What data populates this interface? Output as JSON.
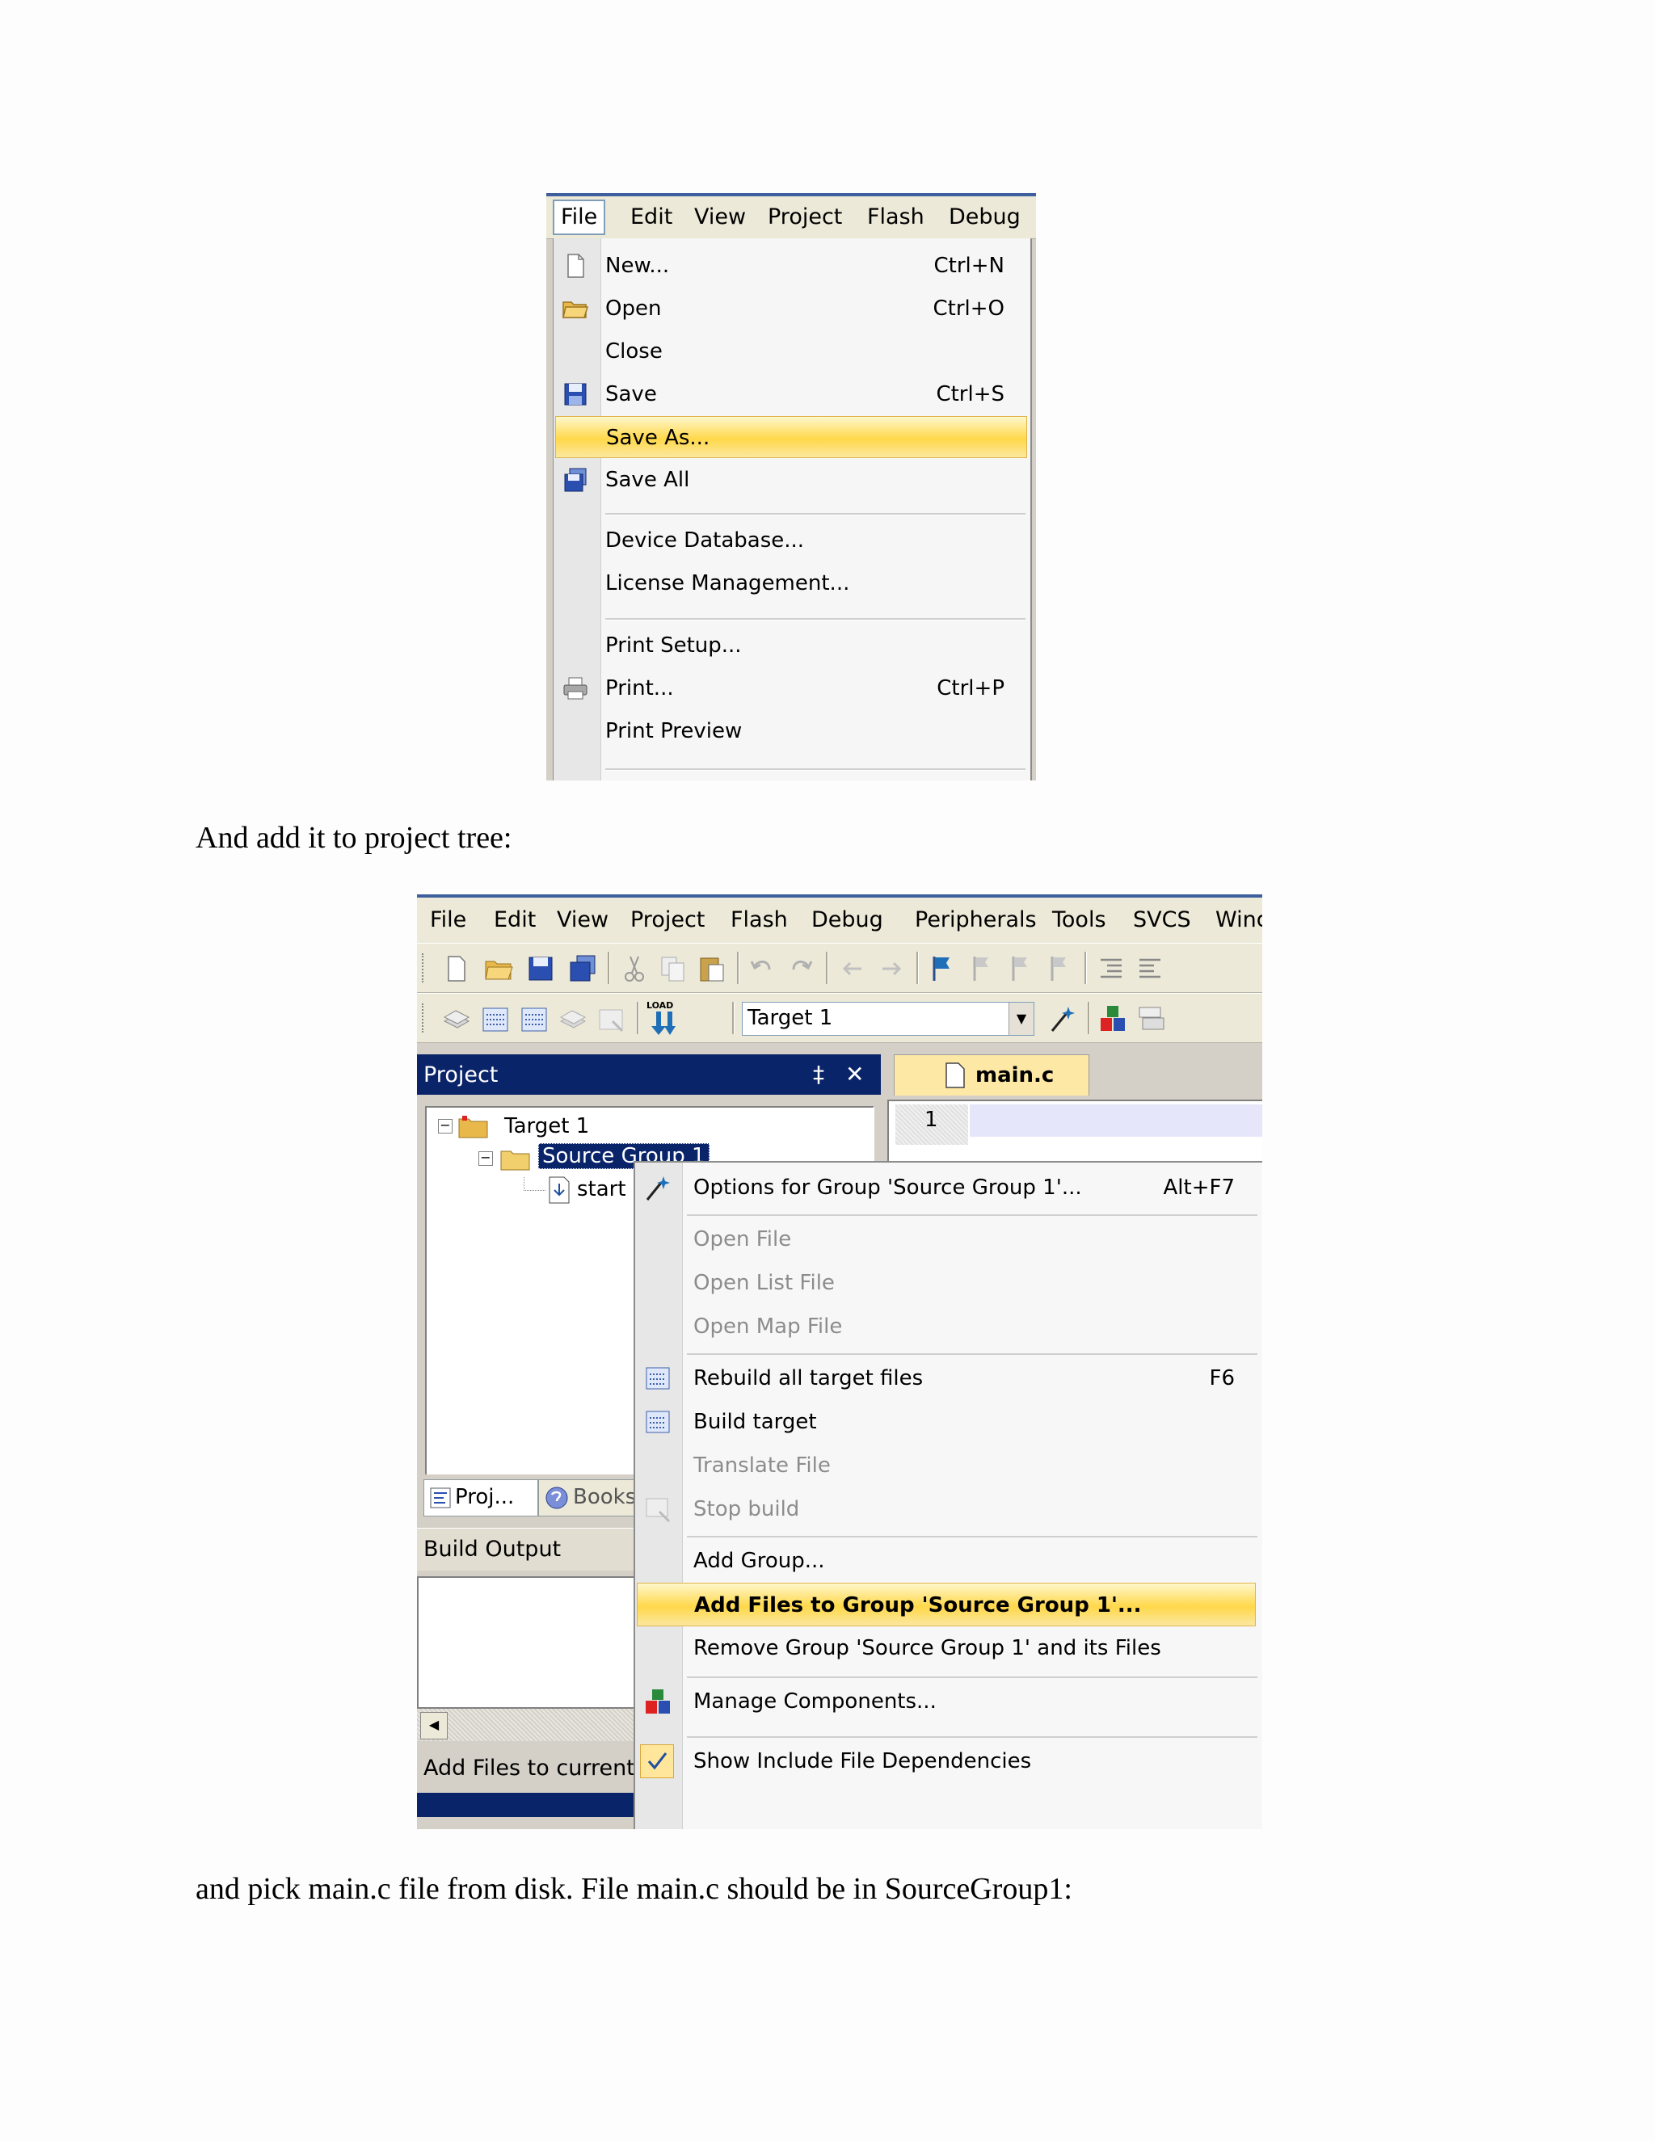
{
  "file_menu_shot": {
    "menubar": [
      "File",
      "Edit",
      "View",
      "Project",
      "Flash",
      "Debug"
    ],
    "items": [
      {
        "label": "New...",
        "shortcut": "Ctrl+N",
        "icon": "new-document-icon"
      },
      {
        "label": "Open",
        "shortcut": "Ctrl+O",
        "icon": "open-folder-icon"
      },
      {
        "label": "Close",
        "shortcut": "",
        "icon": ""
      },
      {
        "label": "Save",
        "shortcut": "Ctrl+S",
        "icon": "save-disk-icon"
      },
      {
        "label": "Save As...",
        "shortcut": "",
        "icon": "",
        "highlighted": true
      },
      {
        "label": "Save All",
        "shortcut": "",
        "icon": "save-all-icon"
      },
      {
        "label": "Device Database...",
        "shortcut": "",
        "icon": ""
      },
      {
        "label": "License Management...",
        "shortcut": "",
        "icon": ""
      },
      {
        "label": "Print Setup...",
        "shortcut": "",
        "icon": ""
      },
      {
        "label": "Print...",
        "shortcut": "Ctrl+P",
        "icon": "printer-icon"
      },
      {
        "label": "Print Preview",
        "shortcut": "",
        "icon": ""
      }
    ]
  },
  "text": {
    "para1": "And add it to project tree:",
    "para2": "and pick main.c file from disk. File main.c should be in SourceGroup1:"
  },
  "ide_shot": {
    "menubar": [
      "File",
      "Edit",
      "View",
      "Project",
      "Flash",
      "Debug",
      "Peripherals",
      "Tools",
      "SVCS",
      "Wind"
    ],
    "target_combo": "Target 1",
    "load_label": "LOAD",
    "project_panel_title": "Project",
    "pin_glyph": "‡",
    "close_glyph": "✕",
    "tree": {
      "target": "Target 1",
      "group": "Source Group 1",
      "file": "start"
    },
    "tabs": [
      "Proj...",
      "Books"
    ],
    "build_output_title": "Build Output",
    "status_text": "Add Files to current P",
    "editor_tab": "main.c",
    "line_number": "1",
    "context_menu": [
      {
        "label": "Options for Group 'Source Group 1'...",
        "shortcut": "Alt+F7",
        "disabled": false,
        "icon": "magic-wand-icon"
      },
      {
        "label": "Open File",
        "shortcut": "",
        "disabled": true,
        "icon": ""
      },
      {
        "label": "Open List File",
        "shortcut": "",
        "disabled": true,
        "icon": ""
      },
      {
        "label": "Open Map File",
        "shortcut": "",
        "disabled": true,
        "icon": ""
      },
      {
        "label": "Rebuild all target files",
        "shortcut": "F6",
        "disabled": false,
        "icon": "rebuild-icon"
      },
      {
        "label": "Build target",
        "shortcut": "",
        "disabled": false,
        "icon": "build-icon"
      },
      {
        "label": "Translate File",
        "shortcut": "",
        "disabled": true,
        "icon": ""
      },
      {
        "label": "Stop build",
        "shortcut": "",
        "disabled": true,
        "icon": "stop-build-icon"
      },
      {
        "label": "Add Group...",
        "shortcut": "",
        "disabled": false,
        "icon": ""
      },
      {
        "label": "Add Files to Group 'Source Group 1'...",
        "shortcut": "",
        "disabled": false,
        "icon": "",
        "highlighted": true
      },
      {
        "label": "Remove Group 'Source Group 1' and its Files",
        "shortcut": "",
        "disabled": false,
        "icon": ""
      },
      {
        "label": "Manage Components...",
        "shortcut": "",
        "disabled": false,
        "icon": "components-icon"
      },
      {
        "label": "Show Include File Dependencies",
        "shortcut": "",
        "disabled": false,
        "icon": "checkmark-icon"
      }
    ]
  }
}
